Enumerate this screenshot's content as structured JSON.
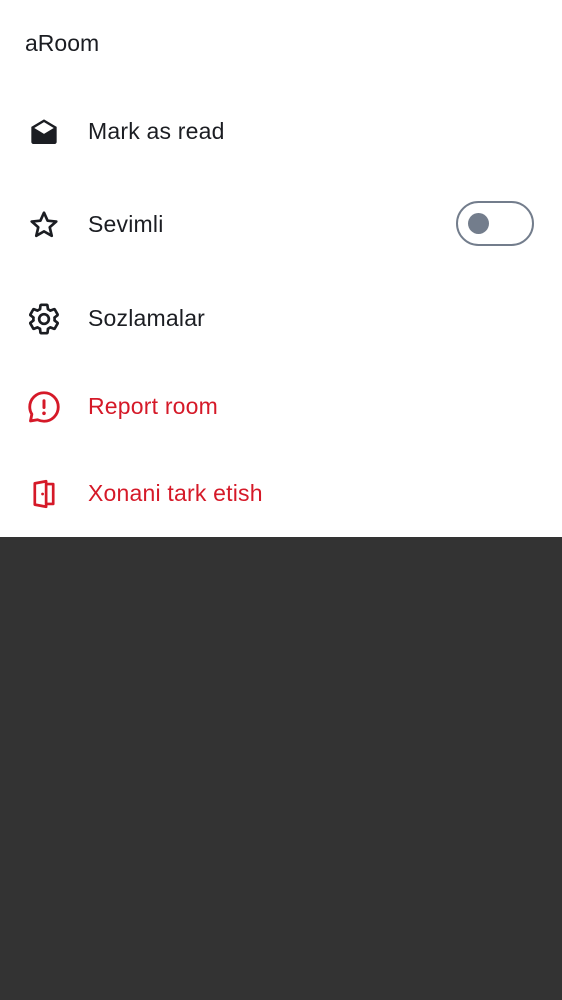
{
  "sheet": {
    "title": "aRoom",
    "items": [
      {
        "id": "mark-read",
        "label": "Mark as read",
        "icon": "envelope-open-icon",
        "variant": "normal"
      },
      {
        "id": "favourite",
        "label": "Sevimli",
        "icon": "star-icon",
        "variant": "normal",
        "toggle": {
          "checked": false
        }
      },
      {
        "id": "settings",
        "label": "Sozlamalar",
        "icon": "gear-icon",
        "variant": "normal"
      },
      {
        "id": "report",
        "label": "Report room",
        "icon": "report-bubble-icon",
        "variant": "danger"
      },
      {
        "id": "leave",
        "label": "Xonani tark etish",
        "icon": "leave-door-icon",
        "variant": "danger"
      }
    ]
  },
  "colors": {
    "text": "#1b1d22",
    "danger": "#d51928",
    "toggle": "#737d8c",
    "scrim": "#333333",
    "sheet": "#ffffff"
  }
}
